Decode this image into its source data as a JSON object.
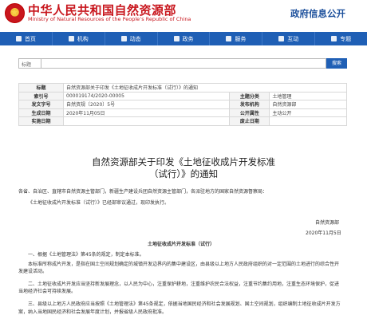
{
  "header": {
    "ministry_cn": "中华人民共和国自然资源部",
    "ministry_en": "Ministry of Natural Resources of the People’s Republic of China",
    "site_title": "政府信息公开"
  },
  "nav": {
    "items": [
      {
        "label": "首页",
        "icon": "home-icon"
      },
      {
        "label": "机构",
        "icon": "building-icon"
      },
      {
        "label": "动态",
        "icon": "news-icon"
      },
      {
        "label": "政务",
        "icon": "gov-icon"
      },
      {
        "label": "服务",
        "icon": "service-icon"
      },
      {
        "label": "互动",
        "icon": "chat-icon"
      },
      {
        "label": "专题",
        "icon": "topic-icon"
      }
    ]
  },
  "search": {
    "select_value": "标题",
    "button_label": "搜索"
  },
  "meta": {
    "title_label": "标题",
    "title_value": "自然资源部关于印发《土地征收成片开发标准（试行）》的通知",
    "index_label": "索引号",
    "index_value": "000019174/2020-00005",
    "subject_label": "主题分类",
    "subject_value": "土地管理",
    "docno_label": "发文字号",
    "docno_value": "自然资规〔2020〕5号",
    "issuer_label": "发布机构",
    "issuer_value": "自然资源部",
    "created_label": "生成日期",
    "created_value": "2020年11月05日",
    "attr_label": "公开属性",
    "attr_value": "主动公开",
    "effective_label": "实施日期",
    "effective_value": "",
    "expire_label": "废止日期",
    "expire_value": ""
  },
  "document": {
    "title_line1": "自然资源部关于印发《土地征收成片开发标准",
    "title_line2": "（试行）》的通知",
    "recipients": "各省、自治区、直辖市自然资源主管部门，新疆生产建设兵团自然资源主管部门，各派驻地方的国家自然资源督察局：",
    "intro": "《土地征收成片开发标准（试行）》已经部审议通过，现印发执行。",
    "signer": "自然资源部",
    "date": "2020年11月5日",
    "std_title": "土地征收成片开发标准（试行）",
    "p1": "一、根据《土地管理法》第45条的规定，制定本标准。",
    "p2": "本标准所称成片开发，是指在国土空间规划确定的城镇开发边界内的集中建设区，由县级以上地方人民政府组织的对一定范围的土地进行的综合性开",
    "p2b": "发建设活动。",
    "p3": "二、土地征收成片开发应当坚持新发展理念，以人民为中心，注重保护耕地，注重维护农民合法权益，注重节约集约用地，注重生态环境保护，促进",
    "p3b": "当地经济社会可持续发展。",
    "p4": "三、县级以上地方人民政府应当按照《土地管理法》第45条规定，依据当地国民经济和社会发展规划、国土空间规划，组织编制土地征收成片开发方",
    "p4b": "案，纳入当地国民经济和社会发展年度计划，并报省级人民政府批准。"
  }
}
